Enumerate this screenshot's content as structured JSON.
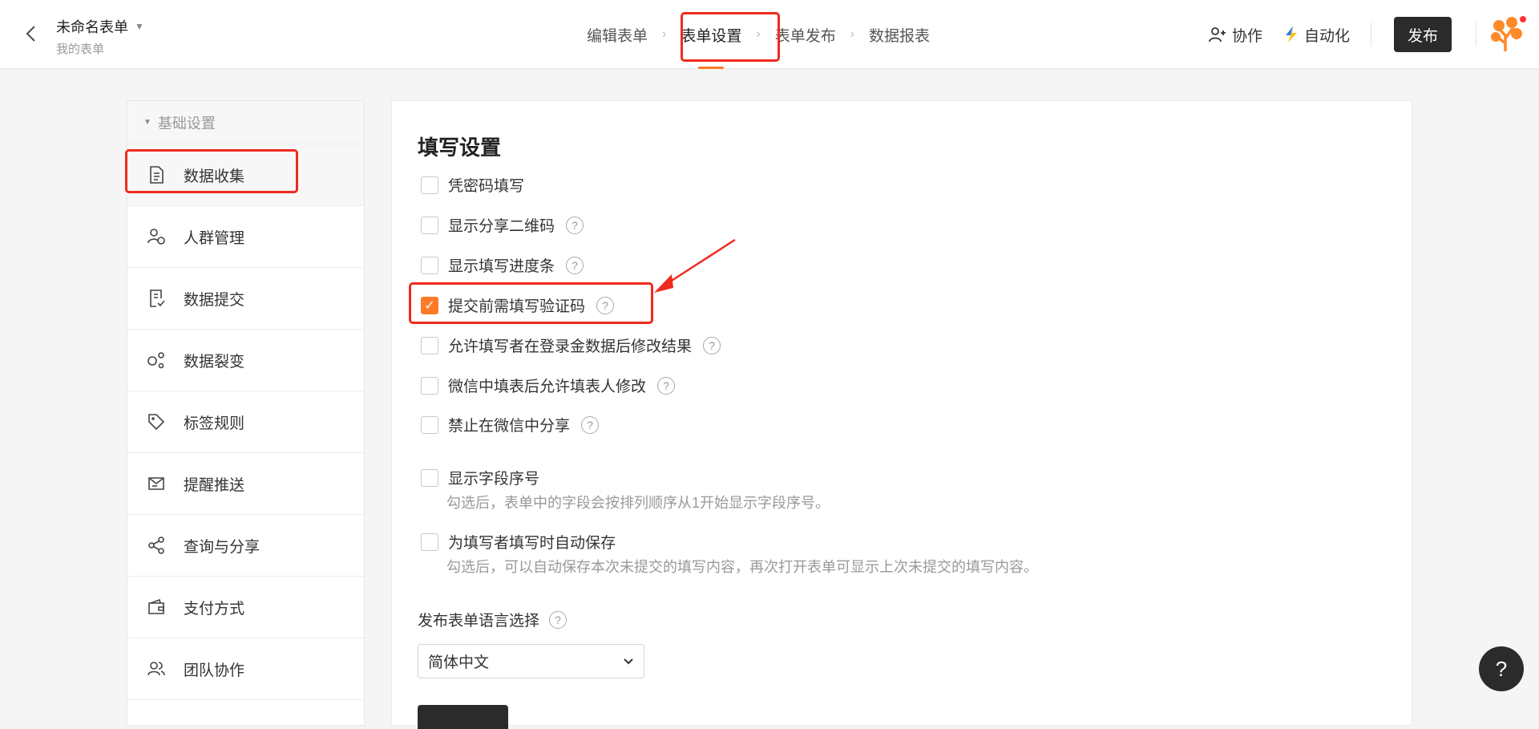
{
  "header": {
    "form_title": "未命名表单",
    "form_subtitle": "我的表单",
    "steps": [
      "编辑表单",
      "表单设置",
      "表单发布",
      "数据报表"
    ],
    "active_step": 1,
    "collaborate_label": "协作",
    "automation_label": "自动化",
    "publish_label": "发布"
  },
  "sidebar": {
    "group_label": "基础设置",
    "items": [
      {
        "label": "数据收集",
        "icon": "document-icon",
        "active": true
      },
      {
        "label": "人群管理",
        "icon": "user-group-icon"
      },
      {
        "label": "数据提交",
        "icon": "submit-doc-icon"
      },
      {
        "label": "数据裂变",
        "icon": "fission-icon"
      },
      {
        "label": "标签规则",
        "icon": "tag-icon"
      },
      {
        "label": "提醒推送",
        "icon": "reminder-icon"
      },
      {
        "label": "查询与分享",
        "icon": "share-icon"
      },
      {
        "label": "支付方式",
        "icon": "wallet-icon"
      },
      {
        "label": "团队协作",
        "icon": "team-icon"
      }
    ]
  },
  "panel": {
    "title": "填写设置",
    "options": [
      {
        "label": "凭密码填写",
        "checked": false,
        "help": false
      },
      {
        "label": "显示分享二维码",
        "checked": false,
        "help": true
      },
      {
        "label": "显示填写进度条",
        "checked": false,
        "help": true
      },
      {
        "label": "提交前需填写验证码",
        "checked": true,
        "help": true
      },
      {
        "label": "允许填写者在登录金数据后修改结果",
        "checked": false,
        "help": true
      },
      {
        "label": "微信中填表后允许填表人修改",
        "checked": false,
        "help": true
      },
      {
        "label": "禁止在微信中分享",
        "checked": false,
        "help": true
      },
      {
        "label": "显示字段序号",
        "checked": false,
        "help": false
      },
      {
        "label": "为填写者填写时自动保存",
        "checked": false,
        "help": false
      }
    ],
    "desc_field_numbers": "勾选后，表单中的字段会按排列顺序从1开始显示字段序号。",
    "desc_autosave": "勾选后，可以自动保存本次未提交的填写内容，再次打开表单可显示上次未提交的填写内容。",
    "language_label": "发布表单语言选择",
    "language_value": "简体中文"
  },
  "colors": {
    "accent": "#ff7a26",
    "annotation": "#ee2b1e",
    "dark_button": "#2b2b2b"
  }
}
